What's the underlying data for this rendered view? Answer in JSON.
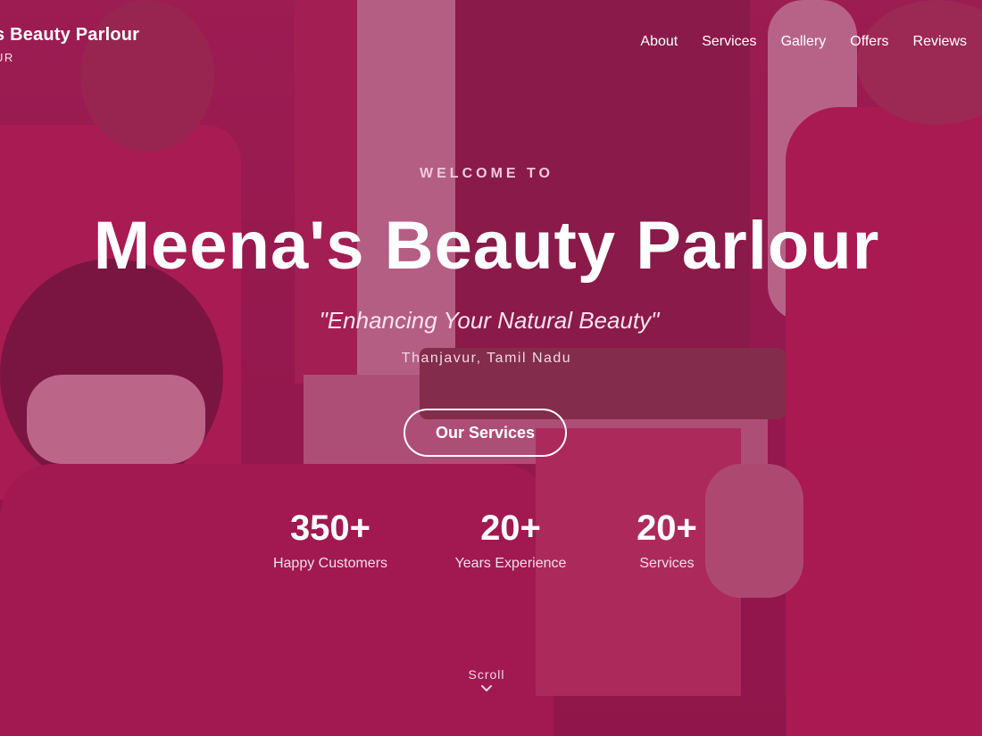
{
  "brand": {
    "name": "s Beauty Parlour",
    "sub": "UR"
  },
  "nav": [
    "About",
    "Services",
    "Gallery",
    "Offers",
    "Reviews"
  ],
  "hero": {
    "welcome": "WELCOME TO",
    "title": "Meena's Beauty Parlour",
    "tagline": "\"Enhancing Your Natural Beauty\"",
    "location": "Thanjavur, Tamil Nadu",
    "cta": "Our Services"
  },
  "stats": [
    {
      "value": "350+",
      "label": "Happy Customers"
    },
    {
      "value": "20+",
      "label": "Years Experience"
    },
    {
      "value": "20+",
      "label": "Services"
    }
  ],
  "scroll": {
    "label": "Scroll",
    "icon": "chevron-down-icon"
  },
  "colors": {
    "overlay": "#96144b",
    "accent": "#ffffff"
  }
}
